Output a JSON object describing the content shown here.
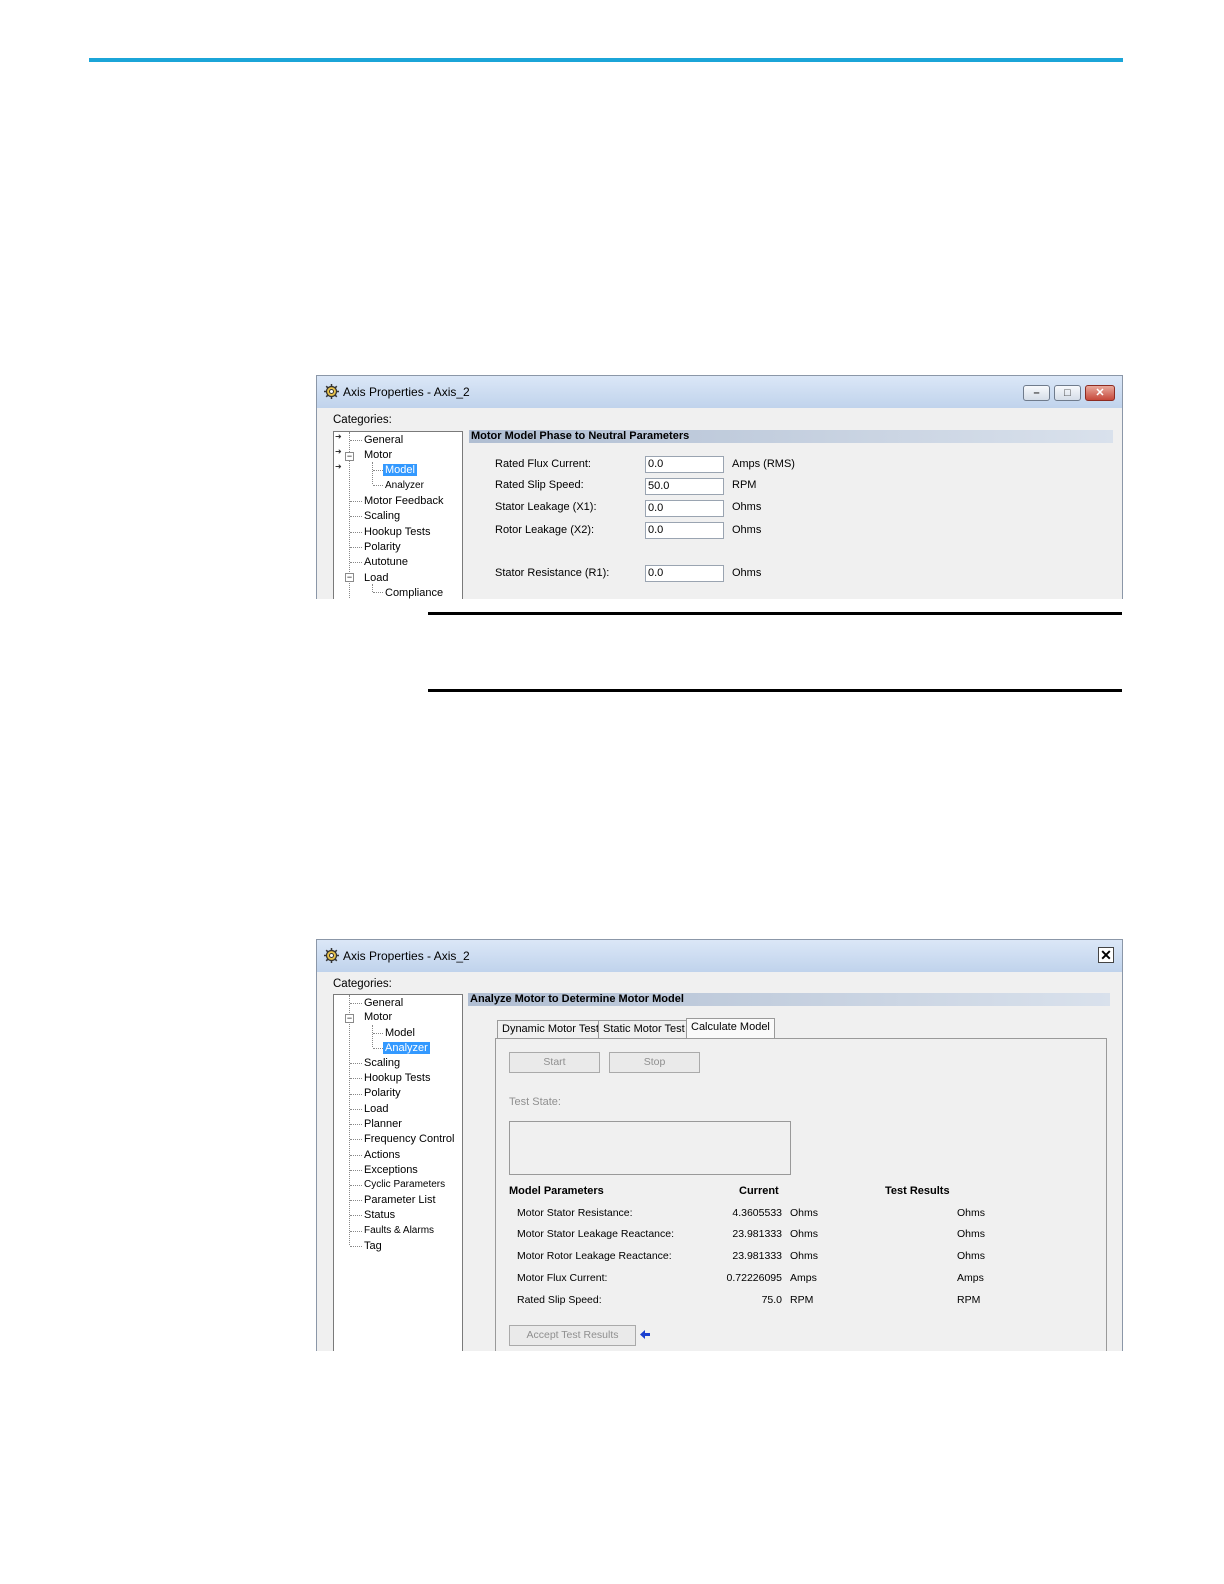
{
  "colors": {
    "accent_rule": "#1ba5d8",
    "selection": "#3399ff",
    "titlebar": "#c9d9ef"
  },
  "dialog1": {
    "title": "Axis Properties - Axis_2",
    "categories_label": "Categories:",
    "tree": [
      "General",
      "Motor",
      "Model",
      "Analyzer",
      "Motor Feedback",
      "Scaling",
      "Hookup Tests",
      "Polarity",
      "Autotune",
      "Load",
      "Compliance"
    ],
    "selected": "Model",
    "section_header": "Motor Model Phase to Neutral Parameters",
    "fields": [
      {
        "label": "Rated Flux Current:",
        "value": "0.0",
        "unit": "Amps (RMS)"
      },
      {
        "label": "Rated Slip Speed:",
        "value": "50.0",
        "unit": "RPM"
      },
      {
        "label": "Stator Leakage (X1):",
        "value": "0.0",
        "unit": "Ohms"
      },
      {
        "label": "Rotor Leakage (X2):",
        "value": "0.0",
        "unit": "Ohms"
      },
      {
        "label": "Stator Resistance (R1):",
        "value": "0.0",
        "unit": "Ohms"
      }
    ]
  },
  "dialog2": {
    "title": "Axis Properties - Axis_2",
    "categories_label": "Categories:",
    "tree": [
      "General",
      "Motor",
      "Model",
      "Analyzer",
      "Scaling",
      "Hookup Tests",
      "Polarity",
      "Load",
      "Planner",
      "Frequency Control",
      "Actions",
      "Exceptions",
      "Cyclic Parameters",
      "Parameter List",
      "Status",
      "Faults & Alarms",
      "Tag"
    ],
    "selected": "Analyzer",
    "section_header": "Analyze Motor to Determine Motor Model",
    "tabs": [
      "Dynamic Motor Test",
      "Static Motor Test",
      "Calculate Model"
    ],
    "active_tab": "Calculate Model",
    "start_label": "Start",
    "stop_label": "Stop",
    "test_state_label": "Test State:",
    "columns": {
      "params": "Model Parameters",
      "current": "Current",
      "results": "Test Results"
    },
    "rows": [
      {
        "name": "Motor Stator Resistance:",
        "current": "4.3605533",
        "unit": "Ohms",
        "result_unit": "Ohms"
      },
      {
        "name": "Motor Stator Leakage Reactance:",
        "current": "23.981333",
        "unit": "Ohms",
        "result_unit": "Ohms"
      },
      {
        "name": "Motor Rotor Leakage Reactance:",
        "current": "23.981333",
        "unit": "Ohms",
        "result_unit": "Ohms"
      },
      {
        "name": "Motor Flux Current:",
        "current": "0.72226095",
        "unit": "Amps",
        "result_unit": "Amps"
      },
      {
        "name": "Rated Slip Speed:",
        "current": "75.0",
        "unit": "RPM",
        "result_unit": "RPM"
      }
    ],
    "accept_label": "Accept Test Results"
  }
}
